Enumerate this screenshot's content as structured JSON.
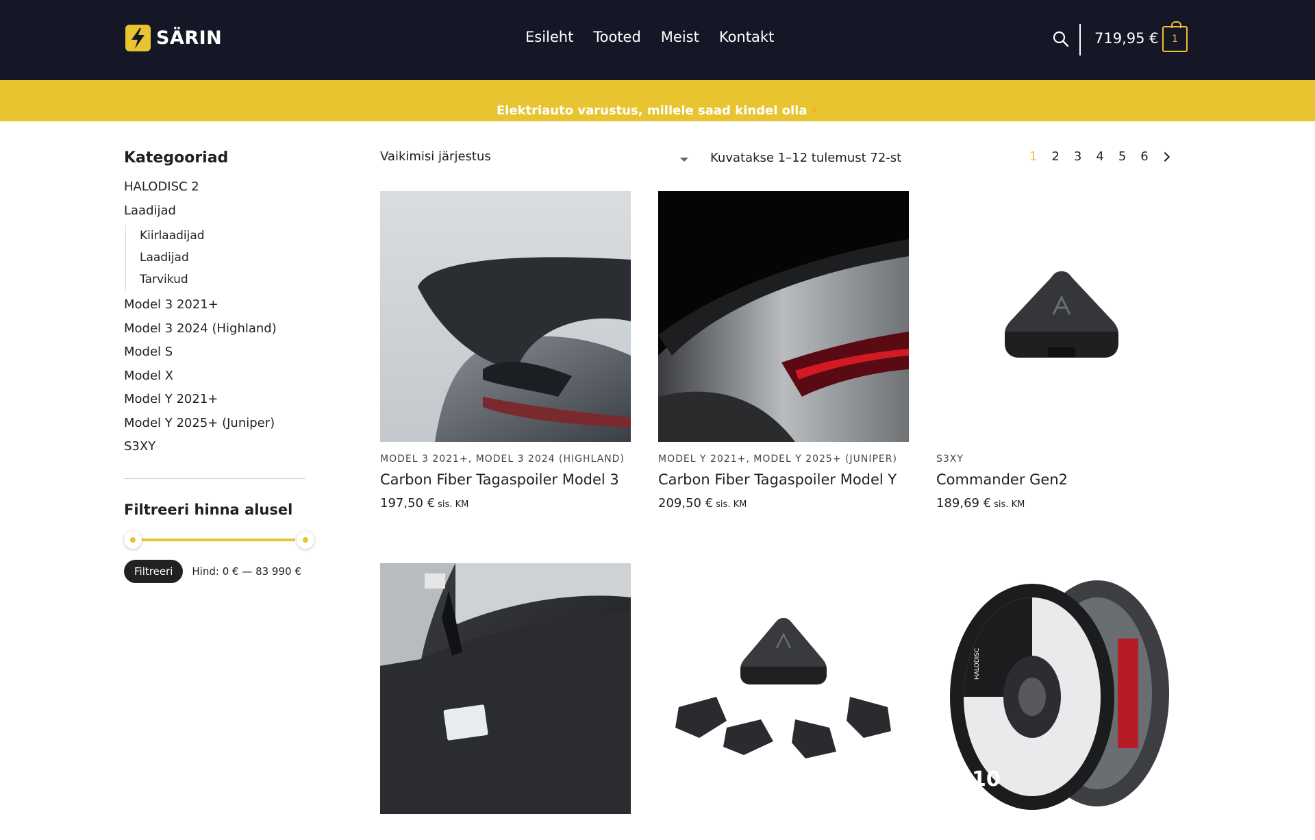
{
  "brand": {
    "name": "SÄRIN",
    "accent_color": "#e8c430",
    "header_bg": "#161726"
  },
  "nav": {
    "items": [
      "Esileht",
      "Tooted",
      "Meist",
      "Kontakt"
    ]
  },
  "header": {
    "search_icon": "search-icon",
    "cart_total": "719,95 €",
    "cart_count": "1",
    "cart_icon": "shopping-bag-icon"
  },
  "banner": {
    "text": "Elektriauto varustus, millele saad kindel olla",
    "icon": "⚡"
  },
  "sidebar": {
    "categories_title": "Kategooriad",
    "categories": [
      "HALODISC 2",
      "Laadijad",
      "Model 3 2021+",
      "Model 3 2024 (Highland)",
      "Model S",
      "Model X",
      "Model Y 2021+",
      "Model Y 2025+ (Juniper)",
      "S3XY"
    ],
    "subcategories": [
      "Kiirlaadijad",
      "Laadijad",
      "Tarvikud"
    ],
    "filter_title": "Filtreeri hinna alusel",
    "filter_button": "Filtreeri",
    "price_range": "Hind: 0 € — 83 990 €",
    "slider_min": 0,
    "slider_max": 83990
  },
  "toolbar": {
    "sort_label": "Vaikimisi järjestus",
    "result_count": "Kuvatakse 1–12 tulemust 72-st",
    "pages": [
      "1",
      "2",
      "3",
      "4",
      "5",
      "6"
    ],
    "current_page": "1"
  },
  "products": [
    {
      "category": "MODEL 3 2021+, MODEL 3 2024 (HIGHLAND)",
      "name": "Carbon Fiber Tagaspoiler Model 3",
      "price": "197,50 €",
      "tax": "sis. KM"
    },
    {
      "category": "MODEL Y 2021+, MODEL Y 2025+ (JUNIPER)",
      "name": "Carbon Fiber Tagaspoiler Model Y",
      "price": "209,50 €",
      "tax": "sis. KM"
    },
    {
      "category": "S3XY",
      "name": "Commander Gen2",
      "price": "189,69 €",
      "tax": "sis. KM"
    },
    {
      "category": "",
      "name": "",
      "price": "",
      "tax": ""
    },
    {
      "category": "",
      "name": "",
      "price": "",
      "tax": ""
    },
    {
      "category": "",
      "name": "",
      "price": "",
      "tax": ""
    }
  ],
  "product_image_text": {
    "wheel_number": "10",
    "wheel_brand": "HALODISC"
  }
}
